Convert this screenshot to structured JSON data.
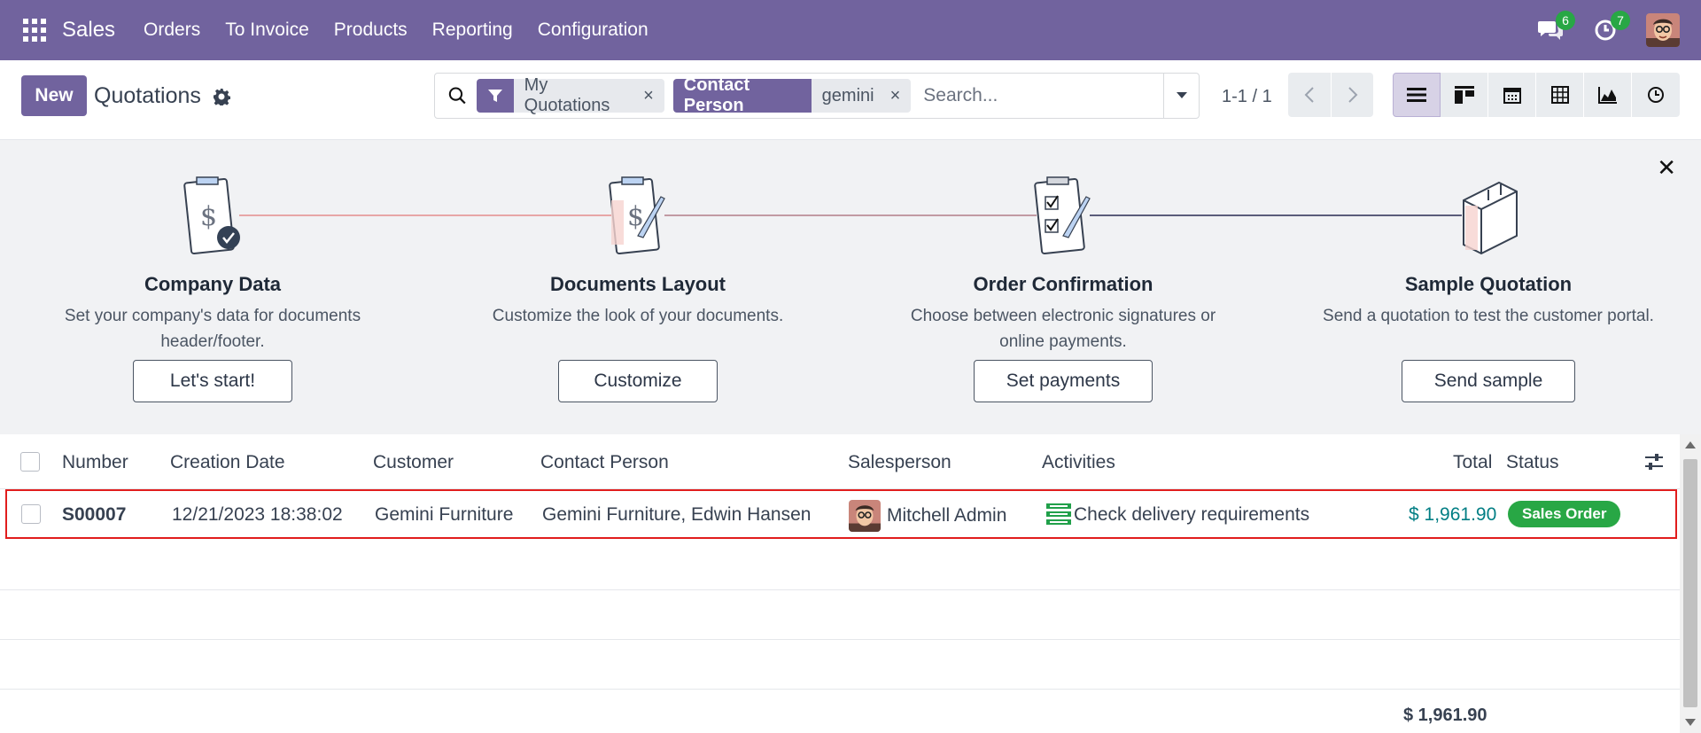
{
  "navbar": {
    "brand": "Sales",
    "menu": [
      "Orders",
      "To Invoice",
      "Products",
      "Reporting",
      "Configuration"
    ],
    "messages_count": "6",
    "activities_count": "7"
  },
  "control_panel": {
    "new_label": "New",
    "title": "Quotations",
    "facets": [
      {
        "label_icon": "filter-icon",
        "value": "My Quotations"
      },
      {
        "label": "Contact Person",
        "value": "gemini"
      }
    ],
    "search_placeholder": "Search...",
    "pager": "1-1 / 1",
    "views": [
      "list-icon",
      "kanban-icon",
      "calendar-icon",
      "pivot-icon",
      "graph-icon",
      "activity-icon"
    ]
  },
  "onboarding": {
    "steps": [
      {
        "title": "Company Data",
        "desc": "Set your company's data for documents header/footer.",
        "button": "Let's start!"
      },
      {
        "title": "Documents Layout",
        "desc": "Customize the look of your documents.",
        "button": "Customize"
      },
      {
        "title": "Order Confirmation",
        "desc": "Choose between electronic signatures or online payments.",
        "button": "Set payments"
      },
      {
        "title": "Sample Quotation",
        "desc": "Send a quotation to test the customer portal.",
        "button": "Send sample"
      }
    ]
  },
  "table": {
    "columns": [
      "Number",
      "Creation Date",
      "Customer",
      "Contact Person",
      "Salesperson",
      "Activities",
      "Total",
      "Status"
    ],
    "rows": [
      {
        "number": "S00007",
        "creation_date": "12/21/2023 18:38:02",
        "customer": "Gemini Furniture",
        "contact": "Gemini Furniture, Edwin Hansen",
        "salesperson": "Mitchell Admin",
        "activity": "Check delivery requirements",
        "total": "$ 1,961.90",
        "status": "Sales Order"
      }
    ],
    "footer_total": "$ 1,961.90"
  },
  "colors": {
    "brand": "#71639e",
    "status_green": "#28a745",
    "total_link": "#017e84",
    "highlight_border": "#e11d1d"
  }
}
